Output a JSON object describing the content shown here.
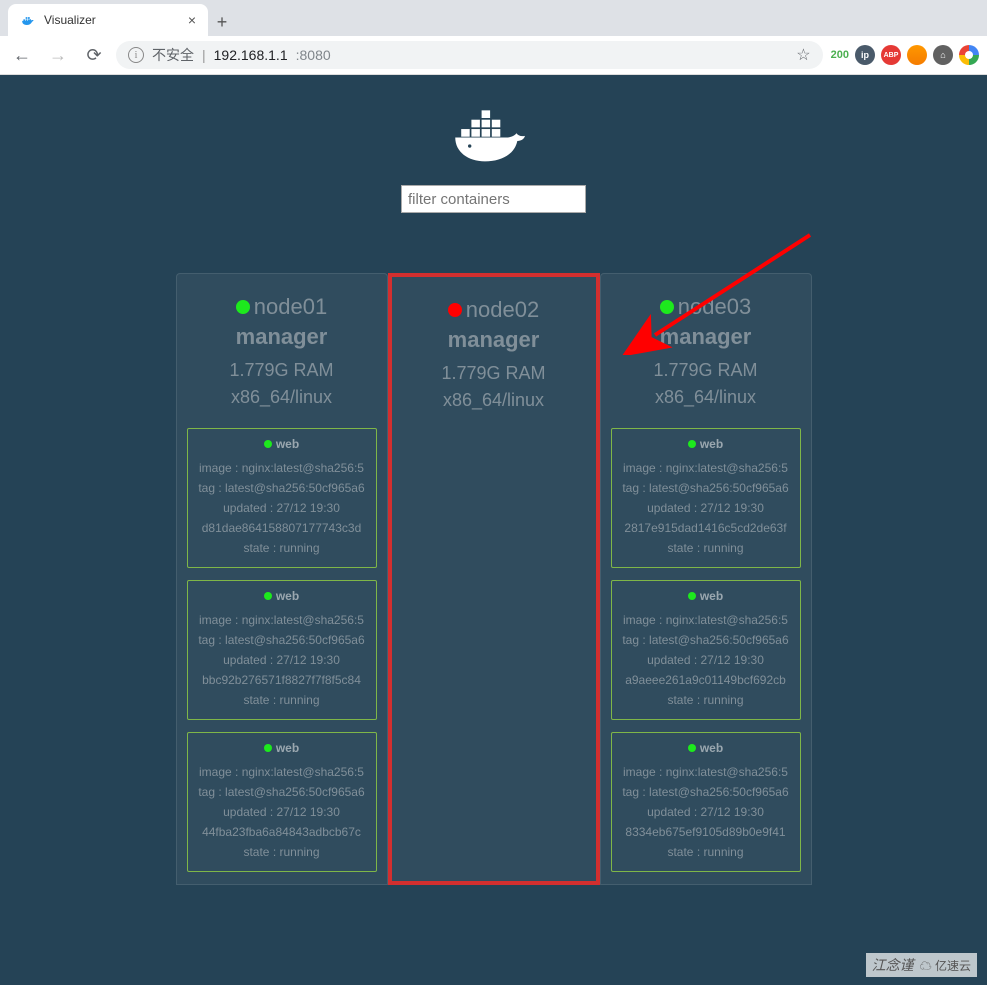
{
  "browser": {
    "tab_title": "Visualizer",
    "insecure_label": "不安全",
    "url_host": "192.168.1.1",
    "url_port": ":8080",
    "ext_status": "200"
  },
  "filter": {
    "placeholder": "filter containers"
  },
  "nodes": [
    {
      "name": "node01",
      "status_color": "green",
      "role": "manager",
      "ram": "1.779G RAM",
      "arch": "x86_64/linux",
      "highlighted": false,
      "containers": [
        {
          "name": "web",
          "image": "image : nginx:latest@sha256:5",
          "tag": "tag : latest@sha256:50cf965a6",
          "updated": "updated : 27/12 19:30",
          "id": "d81dae864158807177743c3d",
          "state": "state : running"
        },
        {
          "name": "web",
          "image": "image : nginx:latest@sha256:5",
          "tag": "tag : latest@sha256:50cf965a6",
          "updated": "updated : 27/12 19:30",
          "id": "bbc92b276571f8827f7f8f5c84",
          "state": "state : running"
        },
        {
          "name": "web",
          "image": "image : nginx:latest@sha256:5",
          "tag": "tag : latest@sha256:50cf965a6",
          "updated": "updated : 27/12 19:30",
          "id": "44fba23fba6a84843adbcb67c",
          "state": "state : running"
        }
      ]
    },
    {
      "name": "node02",
      "status_color": "red",
      "role": "manager",
      "ram": "1.779G RAM",
      "arch": "x86_64/linux",
      "highlighted": true,
      "containers": []
    },
    {
      "name": "node03",
      "status_color": "green",
      "role": "manager",
      "ram": "1.779G RAM",
      "arch": "x86_64/linux",
      "highlighted": false,
      "containers": [
        {
          "name": "web",
          "image": "image : nginx:latest@sha256:5",
          "tag": "tag : latest@sha256:50cf965a6",
          "updated": "updated : 27/12 19:30",
          "id": "2817e915dad1416c5cd2de63f",
          "state": "state : running"
        },
        {
          "name": "web",
          "image": "image : nginx:latest@sha256:5",
          "tag": "tag : latest@sha256:50cf965a6",
          "updated": "updated : 27/12 19:30",
          "id": "a9aeee261a9c01149bcf692cb",
          "state": "state : running"
        },
        {
          "name": "web",
          "image": "image : nginx:latest@sha256:5",
          "tag": "tag : latest@sha256:50cf965a6",
          "updated": "updated : 27/12 19:30",
          "id": "8334eb675ef9105d89b0e9f41",
          "state": "state : running"
        }
      ]
    }
  ],
  "watermark": {
    "text": "江念谨",
    "logo": "亿速云"
  }
}
